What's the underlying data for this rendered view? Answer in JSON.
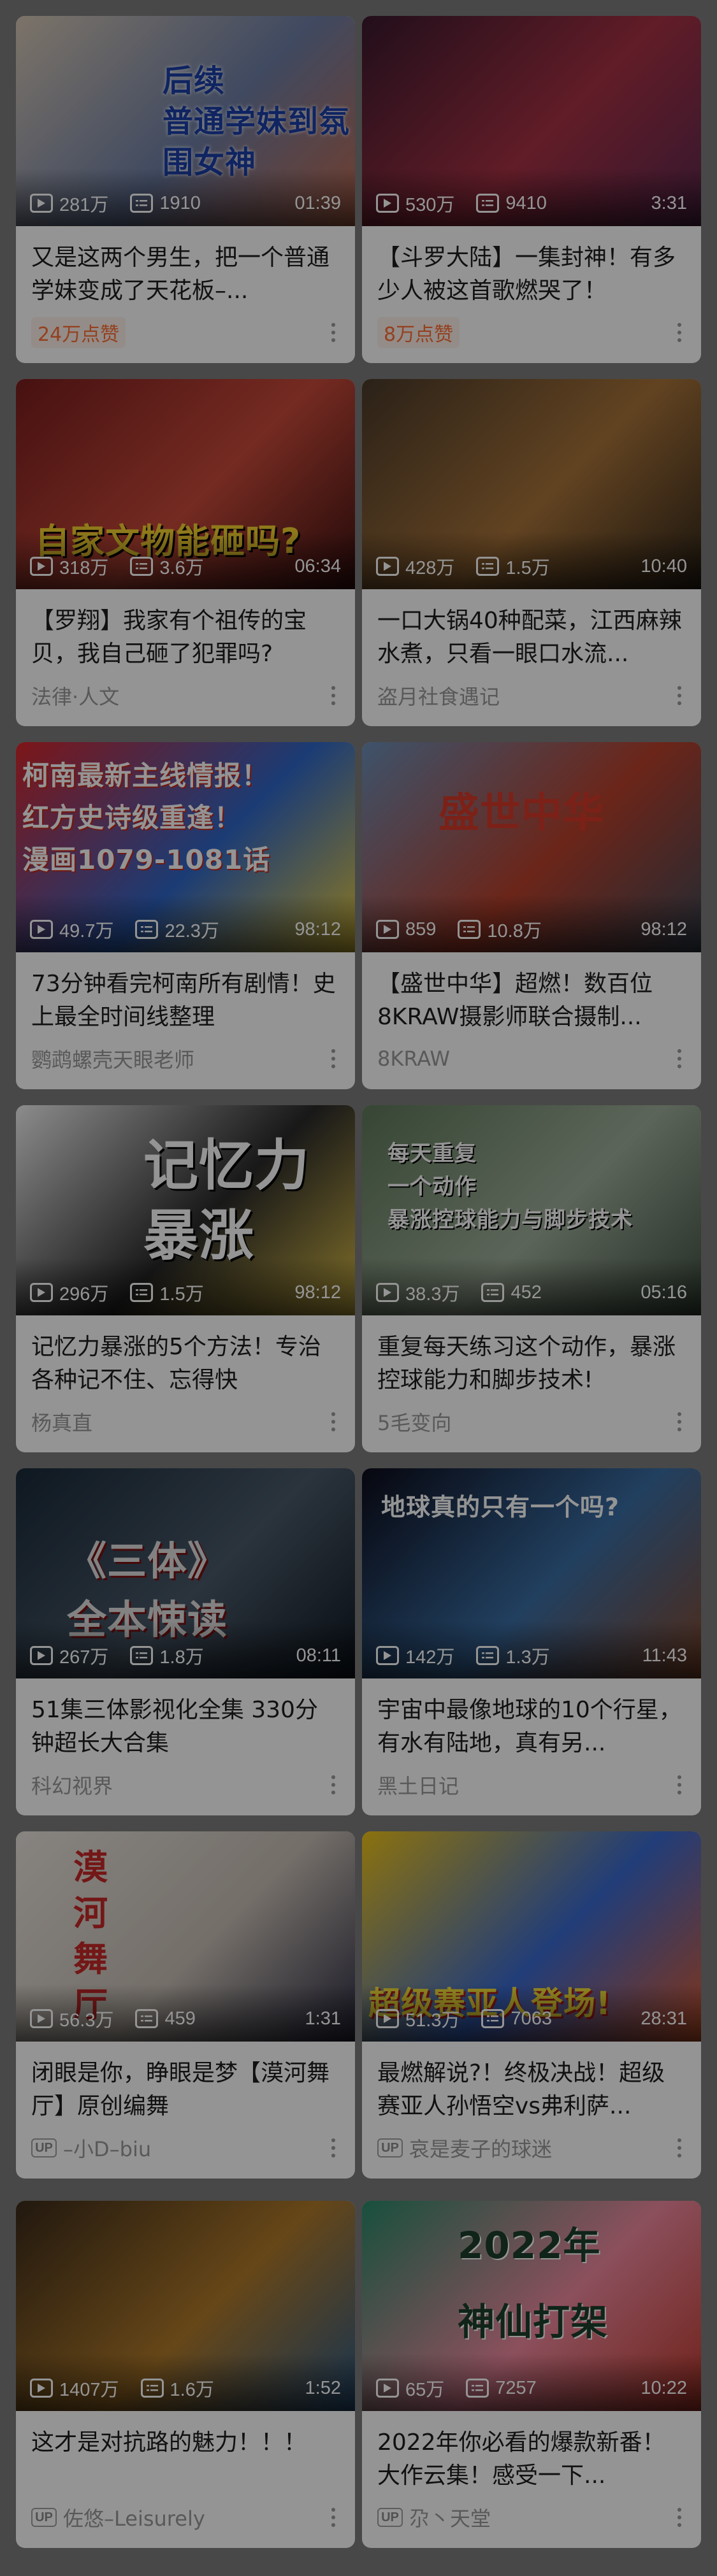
{
  "cards": [
    {
      "overlay": "后续\n普通学妹到氛围女神",
      "views": "281万",
      "danmaku": "1910",
      "duration": "01:39",
      "title": "又是这两个男生，把一个普通学妹变成了天花板–...",
      "meta_type": "hot",
      "meta": "24万点赞",
      "thumb_colors": [
        "#d7c8b5",
        "#6e7fa6",
        "#c46b4e"
      ]
    },
    {
      "overlay": "",
      "views": "530万",
      "danmaku": "9410",
      "duration": "3:31",
      "title": "【斗罗大陆】一集封神！有多少人被这首歌燃哭了！",
      "meta_type": "hot",
      "meta": "8万点赞",
      "thumb_colors": [
        "#3a1a2e",
        "#a83245",
        "#5a2850"
      ]
    },
    {
      "overlay": "自家文物能砸吗?",
      "views": "318万",
      "danmaku": "3.6万",
      "duration": "06:34",
      "title": "【罗翔】我家有个祖传的宝贝，我自己砸了犯罪吗?",
      "meta_type": "text",
      "meta": "法律·人文",
      "thumb_colors": [
        "#7a1e1e",
        "#c94a3a",
        "#3b1010"
      ]
    },
    {
      "overlay": "",
      "views": "428万",
      "danmaku": "1.5万",
      "duration": "10:40",
      "title": "一口大锅40种配菜，江西麻辣水煮，只看一眼口水流...",
      "meta_type": "text",
      "meta": "盗月社食遇记",
      "thumb_colors": [
        "#4a3a2a",
        "#a9743a",
        "#2e2418"
      ]
    },
    {
      "overlay": "柯南最新主线情报！\n红方史诗级重逢！\n漫画1079-1081话",
      "views": "49.7万",
      "danmaku": "22.3万",
      "duration": "98:12",
      "title": "73分钟看完柯南所有剧情！史上最全时间线整理",
      "meta_type": "text",
      "meta": "鹦鹉螺壳天眼老师",
      "thumb_colors": [
        "#d8262a",
        "#2f67c9",
        "#f2d13a"
      ]
    },
    {
      "overlay": "盛世中华",
      "views": "859",
      "danmaku": "10.8万",
      "duration": "98:12",
      "title": "【盛世中华】超燃！数百位8KRAW摄影师联合摄制...",
      "meta_type": "text",
      "meta": "8KRAW",
      "thumb_colors": [
        "#6b8fb8",
        "#b9412c",
        "#3a4a5a"
      ]
    },
    {
      "overlay": "记忆力\n暴涨",
      "views": "296万",
      "danmaku": "1.5万",
      "duration": "98:12",
      "title": "记忆力暴涨的5个方法！专治各种记不住、忘得快",
      "meta_type": "text",
      "meta": "杨真直",
      "thumb_colors": [
        "#f1f1f1",
        "#2a2a2a",
        "#e1c34a"
      ]
    },
    {
      "overlay": "每天重复\n一个动作\n暴涨控球能力与脚步技术",
      "views": "38.3万",
      "danmaku": "452",
      "duration": "05:16",
      "title": "重复每天练习这个动作，暴涨控球能力和脚步技术!",
      "meta_type": "text",
      "meta": "5毛变向",
      "thumb_colors": [
        "#5f7a5a",
        "#9fae9a",
        "#3e4e40"
      ]
    },
    {
      "overlay": "《三体》\n全本悚读",
      "views": "267万",
      "danmaku": "1.8万",
      "duration": "08:11",
      "title": "51集三体影视化全集 330分钟超长大合集",
      "meta_type": "text",
      "meta": "科幻视界",
      "thumb_colors": [
        "#1a2a3a",
        "#4a5a6a",
        "#0e1620"
      ]
    },
    {
      "overlay": "地球真的只有一个吗?",
      "views": "142万",
      "danmaku": "1.3万",
      "duration": "11:43",
      "title": "宇宙中最像地球的10个行星，有水有陆地，真有另...",
      "meta_type": "text",
      "meta": "黑土日记",
      "thumb_colors": [
        "#0c0c1a",
        "#3a6ea5",
        "#8a4a2a"
      ]
    },
    {
      "overlay": "漠河舞厅",
      "views": "56.3万",
      "danmaku": "459",
      "duration": "1:31",
      "title": "闭眼是你，睁眼是梦【漠河舞厅】原创编舞",
      "meta_type": "up",
      "meta": "–小D–biu",
      "thumb_colors": [
        "#e9e4de",
        "#c8bfb5",
        "#2a2a40"
      ]
    },
    {
      "overlay": "超级赛亚人登场!",
      "views": "51.3万",
      "danmaku": "7063",
      "duration": "28:31",
      "title": "最燃解说?！终极决战！超级赛亚人孙悟空vs弗利萨...",
      "meta_type": "up",
      "meta": "哀是麦子的球迷",
      "thumb_colors": [
        "#f0c419",
        "#3a6ad0",
        "#e25b2a"
      ]
    },
    {
      "overlay": "",
      "views": "1407万",
      "danmaku": "1.6万",
      "duration": "1:52",
      "title": "这才是对抗路的魅力！！！",
      "meta_type": "up",
      "meta": "佐悠–Leisurely",
      "thumb_colors": [
        "#3a2a1a",
        "#b07a2a",
        "#2a5a8a"
      ]
    },
    {
      "overlay": "2022年\n神仙打架",
      "views": "65万",
      "danmaku": "7257",
      "duration": "10:22",
      "title": "2022年你必看的爆款新番！大作云集！感受一下...",
      "meta_type": "up",
      "meta": "尕丶天堂",
      "thumb_colors": [
        "#2a8a6a",
        "#f08aa0",
        "#c0392b"
      ]
    }
  ],
  "labels": {
    "up": "UP"
  }
}
